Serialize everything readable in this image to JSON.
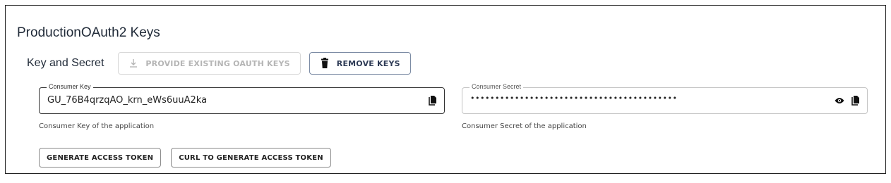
{
  "panel": {
    "title": "ProductionOAuth2 Keys",
    "section_label": "Key and Secret",
    "provide_keys_button": "PROVIDE EXISTING OAUTH KEYS",
    "remove_keys_button": "REMOVE KEYS"
  },
  "consumer_key": {
    "label": "Consumer Key",
    "value": "GU_76B4qrzqAO_krn_eWs6uuA2ka",
    "helper": "Consumer Key of the application"
  },
  "consumer_secret": {
    "label": "Consumer Secret",
    "value": "••••••••••••••••••••••••••••••••••••••••••",
    "helper": "Consumer Secret of the application"
  },
  "actions": {
    "generate_token": "GENERATE ACCESS TOKEN",
    "curl_token": "CURL TO GENERATE ACCESS TOKEN"
  },
  "icons": {
    "provide": "download-icon",
    "remove": "trash-icon",
    "copy": "copy-icon",
    "show": "eye-icon"
  }
}
